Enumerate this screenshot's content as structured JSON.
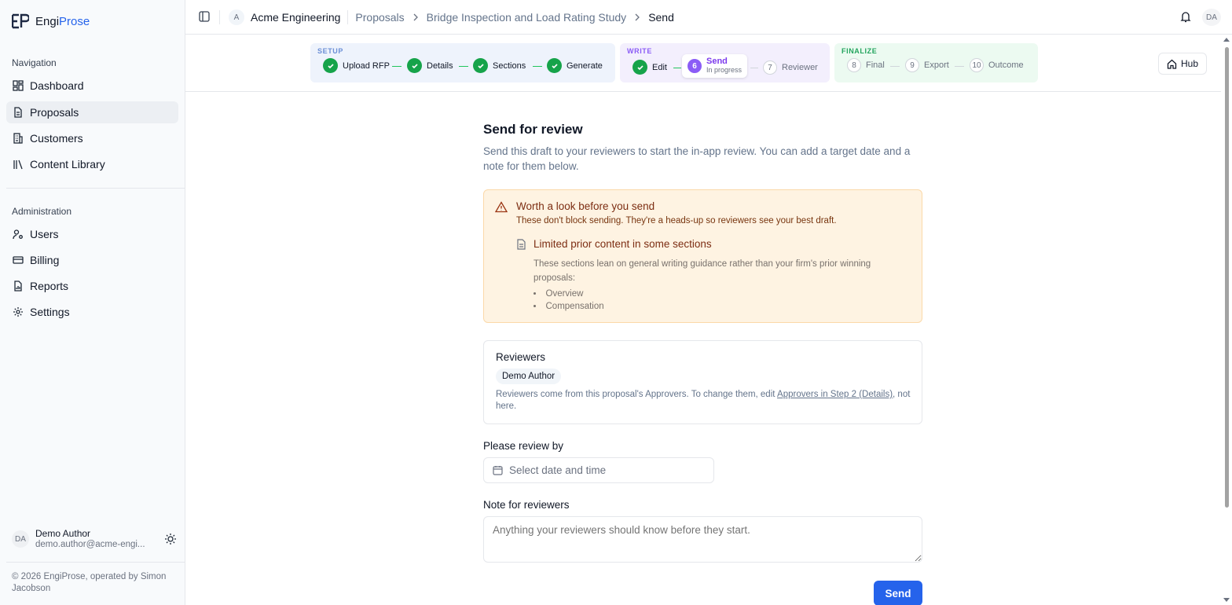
{
  "brand": {
    "prefix": "Engi",
    "suffix": "Prose"
  },
  "sidebar": {
    "nav_heading": "Navigation",
    "nav_items": [
      {
        "label": "Dashboard"
      },
      {
        "label": "Proposals"
      },
      {
        "label": "Customers"
      },
      {
        "label": "Content Library"
      }
    ],
    "admin_heading": "Administration",
    "admin_items": [
      {
        "label": "Users"
      },
      {
        "label": "Billing"
      },
      {
        "label": "Reports"
      },
      {
        "label": "Settings"
      }
    ],
    "user": {
      "initials": "DA",
      "name": "Demo Author",
      "email": "demo.author@acme-engi..."
    },
    "footer": "© 2026 EngiProse, operated by Simon Jacobson"
  },
  "header": {
    "org_initial": "A",
    "org": "Acme Engineering",
    "breadcrumbs": [
      "Proposals",
      "Bridge Inspection and Load Rating Study",
      "Send"
    ],
    "avatar": "DA"
  },
  "stepper": {
    "groups": [
      {
        "label": "SETUP",
        "color": "#6b8fd6",
        "bg": "#eef3fc"
      },
      {
        "label": "WRITE",
        "color": "#8b5cf6",
        "bg": "#f3effd"
      },
      {
        "label": "FINALIZE",
        "color": "#22a45d",
        "bg": "#ecfaf1"
      }
    ],
    "steps": [
      {
        "label": "Upload RFP",
        "status": "done"
      },
      {
        "label": "Details",
        "status": "done"
      },
      {
        "label": "Sections",
        "status": "done"
      },
      {
        "label": "Generate",
        "status": "done"
      },
      {
        "label": "Edit",
        "status": "done"
      },
      {
        "num": "6",
        "label": "Send",
        "sub": "In progress",
        "status": "current"
      },
      {
        "num": "7",
        "label": "Reviewer",
        "status": "todo"
      },
      {
        "num": "8",
        "label": "Final",
        "status": "todo"
      },
      {
        "num": "9",
        "label": "Export",
        "status": "todo"
      },
      {
        "num": "10",
        "label": "Outcome",
        "status": "todo"
      }
    ],
    "hub_label": "Hub"
  },
  "main": {
    "title": "Send for review",
    "description": "Send this draft to your reviewers to start the in-app review. You can add a target date and a note for them below.",
    "warning": {
      "title": "Worth a look before you send",
      "subtitle": "These don't block sending. They're a heads-up so reviewers see your best draft.",
      "item_title": "Limited prior content in some sections",
      "item_body": "These sections lean on general writing guidance rather than your firm's prior winning proposals:",
      "sections": [
        "Overview",
        "Compensation"
      ]
    },
    "reviewers": {
      "title": "Reviewers",
      "chip": "Demo Author",
      "note_before": "Reviewers come from this proposal's Approvers. To change them, edit ",
      "note_link": "Approvers in Step 2 (Details)",
      "note_after": ", not here."
    },
    "review_by_label": "Please review by",
    "date_placeholder": "Select date and time",
    "note_label": "Note for reviewers",
    "note_placeholder": "Anything your reviewers should know before they start.",
    "send_label": "Send"
  }
}
